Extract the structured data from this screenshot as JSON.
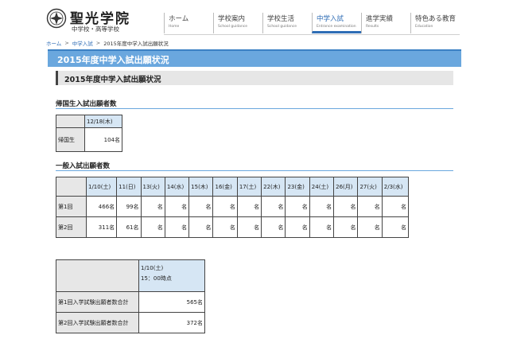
{
  "header": {
    "school_name": "聖光学院",
    "school_sub": "中学校・高等学校",
    "crest_icon": "school-crest-icon"
  },
  "nav": [
    {
      "jp": "ホーム",
      "en": "Home",
      "active": false
    },
    {
      "jp": "学校案内",
      "en": "School guidance",
      "active": false
    },
    {
      "jp": "学校生活",
      "en": "School guidance",
      "active": false
    },
    {
      "jp": "中学入試",
      "en": "Entrance examination",
      "active": true
    },
    {
      "jp": "進学実績",
      "en": "Results",
      "active": false
    },
    {
      "jp": "特色ある教育",
      "en": "Education",
      "active": false
    }
  ],
  "breadcrumb": {
    "home": "ホーム",
    "sep": ">",
    "section": "中学入試",
    "current": "2015年度中学入試出願状況"
  },
  "page_title": "2015年度中学入試出願状況",
  "sub_title": "2015年度中学入試出願状況",
  "returnee": {
    "heading": "帰国生入試出願者数",
    "date": "12/18(木)",
    "row_label": "帰国生",
    "value": "104名"
  },
  "general": {
    "heading": "一般入試出願者数",
    "dates": [
      "1/10(土)",
      "11(日)",
      "13(火)",
      "14(水)",
      "15(木)",
      "16(金)",
      "17(土)",
      "22(木)",
      "23(金)",
      "24(土)",
      "26(月)",
      "27(火)",
      "2/3(水)"
    ],
    "rows": [
      {
        "label": "第1回",
        "values": [
          "466名",
          "99名",
          "名",
          "名",
          "名",
          "名",
          "名",
          "名",
          "名",
          "名",
          "名",
          "名",
          "名"
        ]
      },
      {
        "label": "第2回",
        "values": [
          "311名",
          "61名",
          "名",
          "名",
          "名",
          "名",
          "名",
          "名",
          "名",
          "名",
          "名",
          "名",
          "名"
        ]
      }
    ]
  },
  "totals": {
    "date": "1/10(土)",
    "time": "15：00時点",
    "rows": [
      {
        "label": "第1回入学試験出願者数合計",
        "value": "565名"
      },
      {
        "label": "第2回入学試験出願者数合計",
        "value": "372名"
      }
    ]
  },
  "colors": {
    "accent": "#6aa7de",
    "accent_dark": "#3c81c4",
    "table_header": "#d6e6f4",
    "row_header": "#e7e7e7"
  }
}
